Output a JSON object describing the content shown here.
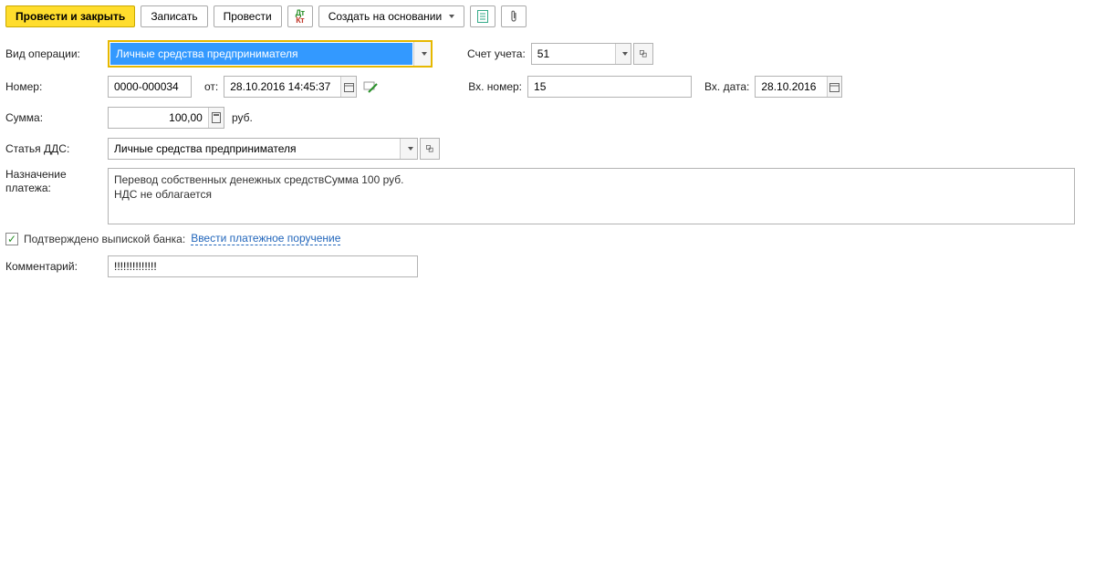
{
  "toolbar": {
    "post_and_close": "Провести и закрыть",
    "record": "Записать",
    "post": "Провести",
    "create_based_on": "Создать на основании"
  },
  "labels": {
    "operation_type": "Вид операции:",
    "account": "Счет учета:",
    "number": "Номер:",
    "from": "от:",
    "in_number": "Вх. номер:",
    "in_date": "Вх. дата:",
    "amount": "Сумма:",
    "currency": "руб.",
    "dds": "Статья ДДС:",
    "payment_purpose": "Назначение платежа:",
    "confirmed": "Подтверждено выпиской банка:",
    "enter_payment_order": "Ввести платежное поручение",
    "comment": "Комментарий:"
  },
  "values": {
    "operation_type": "Личные средства предпринимателя",
    "account": "51",
    "number": "0000-000034",
    "datetime": "28.10.2016 14:45:37",
    "in_number": "15",
    "in_date": "28.10.2016",
    "amount": "100,00",
    "dds": "Личные средства предпринимателя",
    "purpose": "Перевод собственных денежных средствСумма 100 руб.\nНДС не облагается",
    "confirmed": true,
    "comment": "!!!!!!!!!!!!!!"
  }
}
